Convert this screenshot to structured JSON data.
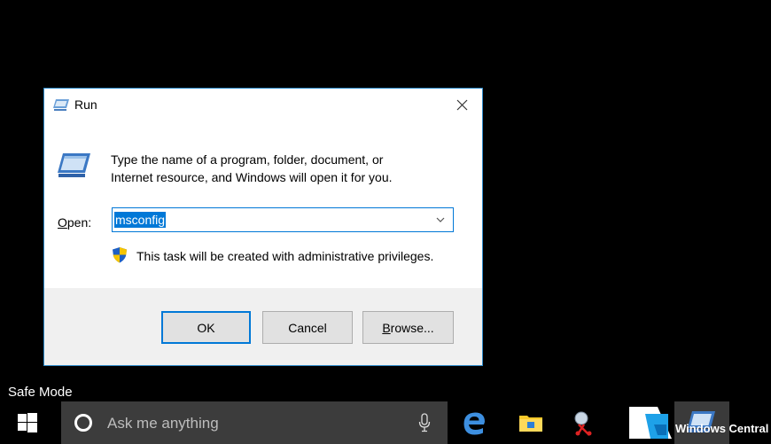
{
  "dialog": {
    "title": "Run",
    "description_line1": "Type the name of a program, folder, document, or",
    "description_line2": "Internet resource, and Windows will open it for you.",
    "open_label_prefix": "O",
    "open_label_rest": "pen:",
    "input_value": "msconfig",
    "admin_note": "This task will be created with administrative privileges.",
    "ok_label": "OK",
    "cancel_label": "Cancel",
    "browse_label_prefix": "B",
    "browse_label_rest": "rowse...",
    "close_glyph": "✕"
  },
  "desktop": {
    "safe_mode_label": "Safe Mode"
  },
  "taskbar": {
    "search_placeholder": "Ask me anything",
    "watermark": "Windows Central"
  },
  "icons": {
    "run": "run-icon",
    "shield": "uac-shield-icon",
    "start": "windows-start-icon",
    "cortana": "cortana-icon",
    "mic": "microphone-icon",
    "edge": "edge-browser-icon",
    "explorer": "file-explorer-icon",
    "snip": "snipping-tool-icon",
    "paint": "paint-icon"
  },
  "colors": {
    "accent": "#0078d7",
    "dialog_border": "#2e8ac9",
    "footer_bg": "#f0f0f0",
    "taskbar_search_bg": "#3c3c3c"
  }
}
